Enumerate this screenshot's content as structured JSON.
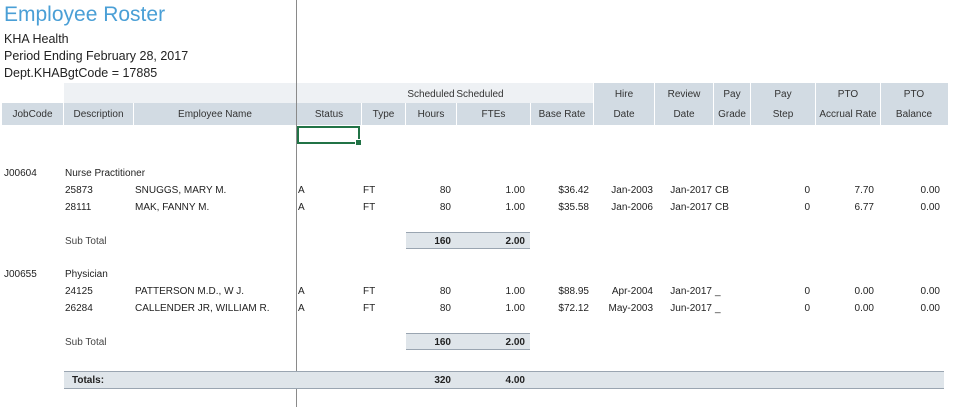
{
  "report": {
    "title": "Employee Roster",
    "org": "KHA Health",
    "period": "Period Ending February 28, 2017",
    "dept": "Dept.KHABgtCode = 17885"
  },
  "columns": {
    "jobcode": "JobCode",
    "description": "Description",
    "employee_name": "Employee Name",
    "status": "Status",
    "type": "Type",
    "hours_top": "Scheduled",
    "hours": "Hours",
    "ftes_top": "Scheduled",
    "ftes": "FTEs",
    "base_rate": "Base Rate",
    "hire_top": "Hire",
    "hire": "Date",
    "review_top": "Review",
    "review": "Date",
    "pay_grade_top": "Pay",
    "pay_grade": "Grade",
    "pay_step_top": "Pay",
    "pay_step": "Step",
    "pto_accrual_top": "PTO",
    "pto_accrual": "Accrual Rate",
    "pto_balance_top": "PTO",
    "pto_balance": "Balance"
  },
  "groups": [
    {
      "jobcode": "J00604",
      "description": "Nurse Practitioner",
      "rows": [
        {
          "id": "25873",
          "name": "SNUGGS, MARY M.",
          "status": "A",
          "type": "FT",
          "hours": "80",
          "ftes": "1.00",
          "rate": "$36.42",
          "hire": "Jan-2003",
          "review": "Jan-2017",
          "grade": "CB",
          "step": "0",
          "accrual": "7.70",
          "balance": "0.00"
        },
        {
          "id": "28111",
          "name": "MAK, FANNY M.",
          "status": "A",
          "type": "FT",
          "hours": "80",
          "ftes": "1.00",
          "rate": "$35.58",
          "hire": "Jan-2006",
          "review": "Jan-2017",
          "grade": "CB",
          "step": "0",
          "accrual": "6.77",
          "balance": "0.00"
        }
      ],
      "subtotal_label": "Sub Total",
      "subtotal_hours": "160",
      "subtotal_ftes": "2.00"
    },
    {
      "jobcode": "J00655",
      "description": "Physician",
      "rows": [
        {
          "id": "24125",
          "name": "PATTERSON M.D., W J.",
          "status": "A",
          "type": "FT",
          "hours": "80",
          "ftes": "1.00",
          "rate": "$88.95",
          "hire": "Apr-2004",
          "review": "Jan-2017",
          "grade": "_",
          "step": "0",
          "accrual": "0.00",
          "balance": "0.00"
        },
        {
          "id": "26284",
          "name": "CALLENDER JR, WILLIAM R.",
          "status": "A",
          "type": "FT",
          "hours": "80",
          "ftes": "1.00",
          "rate": "$72.12",
          "hire": "May-2003",
          "review": "Jun-2017",
          "grade": "_",
          "step": "0",
          "accrual": "0.00",
          "balance": "0.00"
        }
      ],
      "subtotal_label": "Sub Total",
      "subtotal_hours": "160",
      "subtotal_ftes": "2.00"
    }
  ],
  "totals": {
    "label": "Totals:",
    "hours": "320",
    "ftes": "4.00"
  }
}
